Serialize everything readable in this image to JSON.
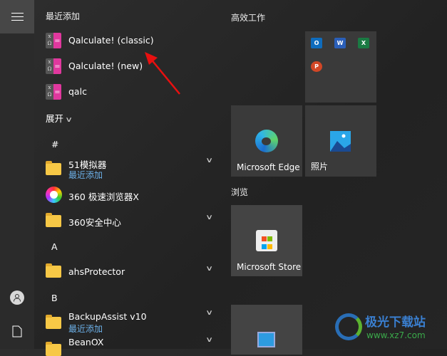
{
  "rail": {
    "menu": "menu-icon",
    "user": "user-icon",
    "documents": "document-icon"
  },
  "list": {
    "recent_header": "最近添加",
    "recent": [
      {
        "label": "Qalculate! (classic)"
      },
      {
        "label": "Qalculate! (new)"
      },
      {
        "label": "qalc"
      }
    ],
    "expand_label": "展开",
    "groups": [
      {
        "letter": "#",
        "items": [
          {
            "label": "51模拟器",
            "sub": "最近添加",
            "type": "folder"
          },
          {
            "label": "360 极速浏览器X",
            "type": "app"
          },
          {
            "label": "360安全中心",
            "type": "folder"
          }
        ]
      },
      {
        "letter": "A",
        "items": [
          {
            "label": "ahsProtector",
            "type": "folder"
          }
        ]
      },
      {
        "letter": "B",
        "items": [
          {
            "label": "BackupAssist v10",
            "sub": "最近添加",
            "type": "folder"
          },
          {
            "label": "BeanOX",
            "type": "folder"
          }
        ]
      }
    ]
  },
  "tiles": {
    "group1": "高效工作",
    "office": [
      "O",
      "W",
      "X",
      "P"
    ],
    "edge": "Microsoft Edge",
    "photos": "照片",
    "group2": "浏览",
    "store": "Microsoft Store"
  },
  "watermark": {
    "title": "极光下载站",
    "url": "www.xz7.com"
  },
  "colors": {
    "accent": "#6cb0e8",
    "arrow": "#e81010"
  }
}
